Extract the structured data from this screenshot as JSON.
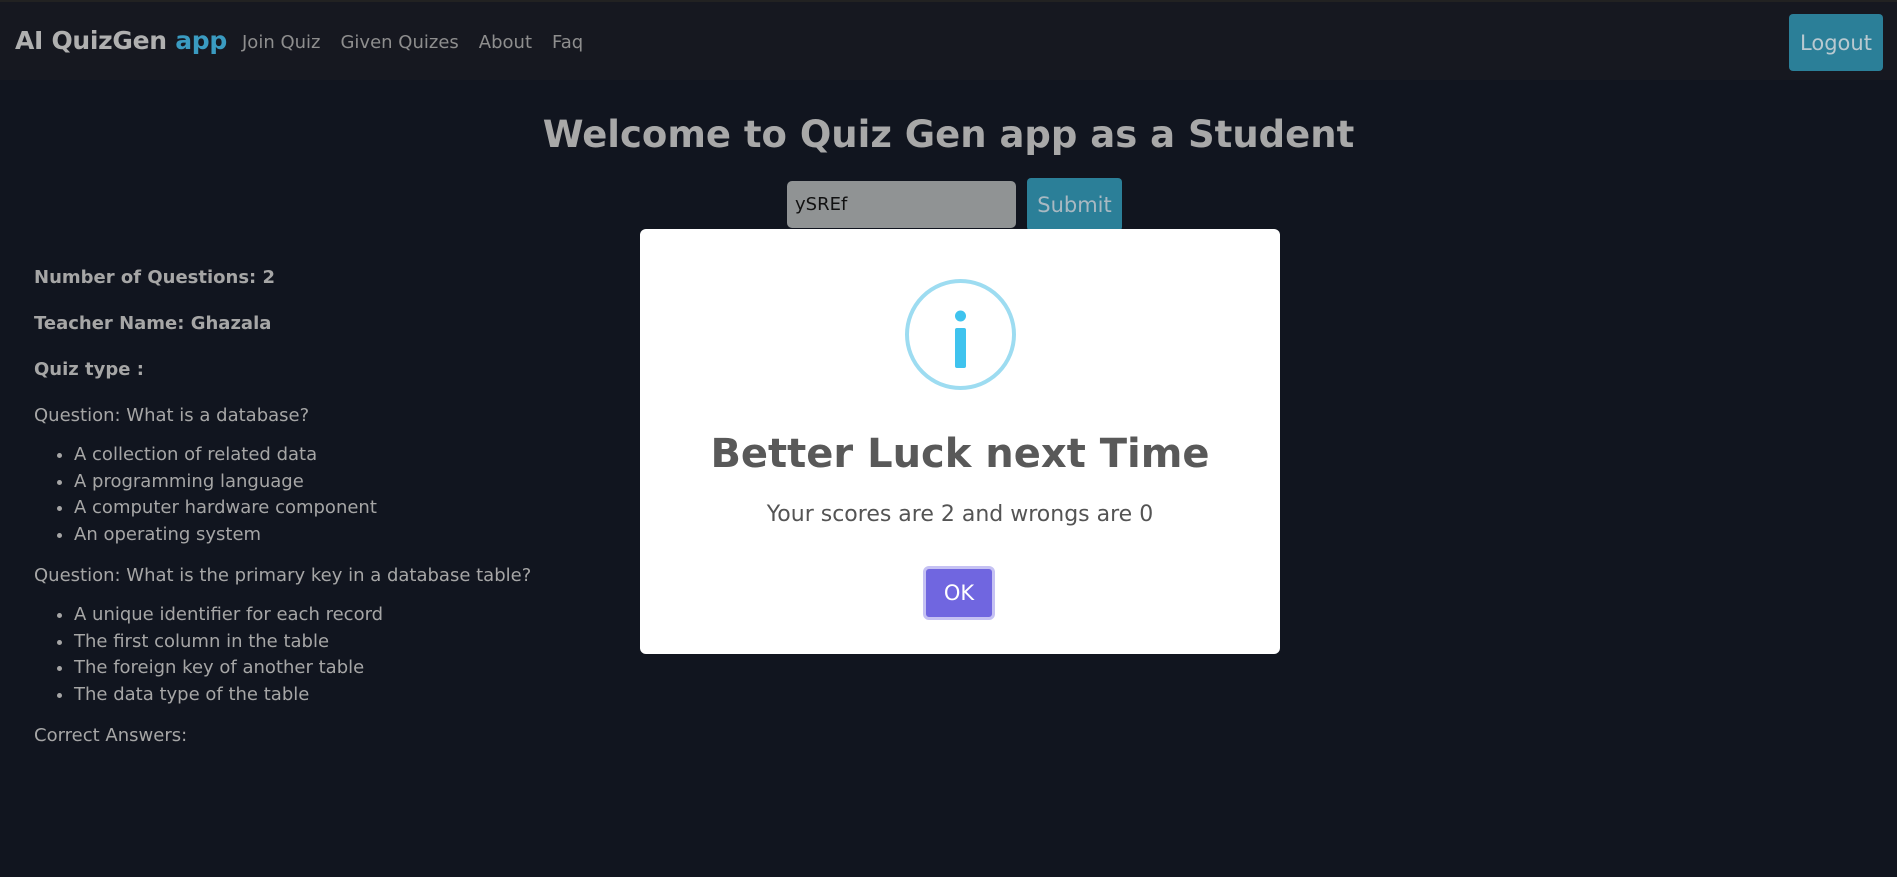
{
  "navbar": {
    "brand_main": "AI QuizGen",
    "brand_accent": "app",
    "links": [
      "Join Quiz",
      "Given Quizes",
      "About",
      "Faq"
    ],
    "logout_label": "Logout"
  },
  "main": {
    "title": "Welcome to Quiz Gen app as a Student",
    "code_value": "ySREf",
    "submit_label": "Submit"
  },
  "quiz": {
    "num_questions": "Number of Questions: 2",
    "teacher": "Teacher Name: Ghazala",
    "quiz_type": "Quiz type :",
    "questions": [
      {
        "text": "Question: What is a database?",
        "options": [
          "A collection of related data",
          "A programming language",
          "A computer hardware component",
          "An operating system"
        ]
      },
      {
        "text": "Question: What is the primary key in a database table?",
        "options": [
          "A unique identifier for each record",
          "The first column in the table",
          "The foreign key of another table",
          "The data type of the table"
        ]
      }
    ],
    "correct_answers": "Correct Answers:"
  },
  "modal": {
    "icon": "info-icon",
    "title": "Better Luck next Time",
    "message": "Your scores are 2 and wrongs are 0",
    "ok_label": "OK"
  },
  "colors": {
    "background": "#11151f",
    "navbar": "#161820",
    "brand_accent": "#3a9bc1",
    "button": "#2b7f98",
    "ok_button": "#7066e0",
    "info_icon": "#3fc3ee"
  }
}
